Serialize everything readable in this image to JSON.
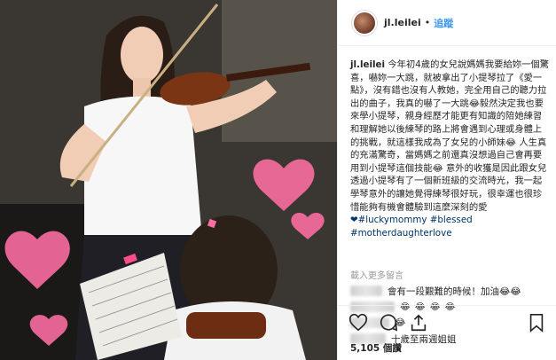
{
  "post": {
    "username": "jl.leilei",
    "separator": "•",
    "follow_label": "追蹤"
  },
  "caption": {
    "user": "jl.leilei",
    "text": " 今年初4歲的女兒說媽媽我要給妳一個驚喜，嚇妳一大跳，就被拿出了小提琴拉了《愛一點》，沒有錯也沒有人教她，完全用自己的聽力拉出的曲子，我真的嚇了一大跳😂毅然決定我也要來學小提琴，親身經歷才能更有知識的陪她練習和理解她以後練琴的路上將會遇到心理或身體上的挑戰，就這樣我成為了女兒的小師妹😂 人生真的充滿驚奇，當媽媽之前還真沒想過自己會再要用到小提琴這個技能😂 意外的收獲是因此跟女兒透過小提琴有了一個新班級的交流時光，我一起學琴意外的讓她覺得練琴很好玩，很幸運也很珍惜能夠有機會體驗到這麼深刻的愛",
    "tags": [
      "❤#luckymommy #blessed",
      "#motherdaughterlove"
    ]
  },
  "more_comments_label": "載入更多留言",
  "comments": [
    {
      "text": "會有一段艱難的時候！加油😂😂",
      "extra": "😂 😂 😂 😂"
    },
    {
      "text": "😂",
      "extra": ""
    },
    {
      "text": "十歲至兩週姐姐",
      "extra": ""
    }
  ],
  "icons": {
    "like": "heart-icon",
    "comment": "comment-icon",
    "share": "share-icon",
    "save": "bookmark-icon"
  },
  "likes_text": "5,105 個讚",
  "colors": {
    "follow_blue": "#3897f0",
    "hashtag_blue": "#003569",
    "heart_pink": "#ff6fa3"
  }
}
